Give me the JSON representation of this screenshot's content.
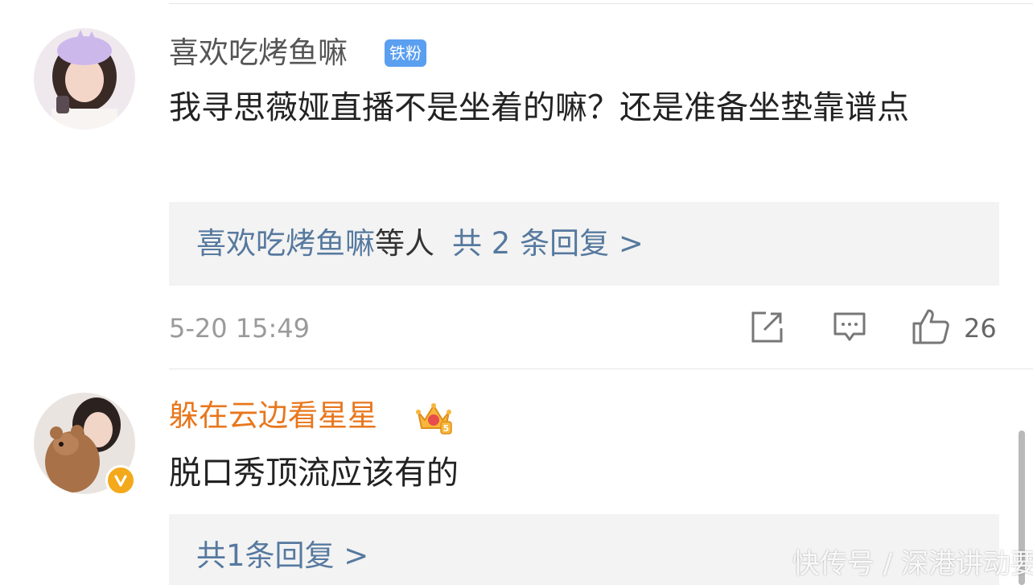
{
  "colors": {
    "username_normal": "#555555",
    "username_vip": "#e8771d",
    "reply_link": "#56799f",
    "badge_bg": "#5b9ff0",
    "verified": "#f3a91b"
  },
  "comments": [
    {
      "username": "喜欢吃烤鱼嘛",
      "badge": "铁粉",
      "text": "我寻思薇娅直播不是坐着的嘛？还是准备坐垫靠谱点",
      "reply_names": "喜欢吃烤鱼嘛",
      "reply_etc": "等人",
      "reply_count": "共 2 条回复 >",
      "timestamp": "5-20 15:49",
      "like_count": "26",
      "icons": [
        "share-icon",
        "comment-icon",
        "like-icon"
      ]
    },
    {
      "username": "躲在云边看星星",
      "member_icon": "crown-level-icon",
      "member_level": "5",
      "verified_icon": "verified-v-icon",
      "text": "脱口秀顶流应该有的",
      "reply_count": "共1条回复 >"
    }
  ],
  "watermark": "快传号 / 深港讲动要"
}
